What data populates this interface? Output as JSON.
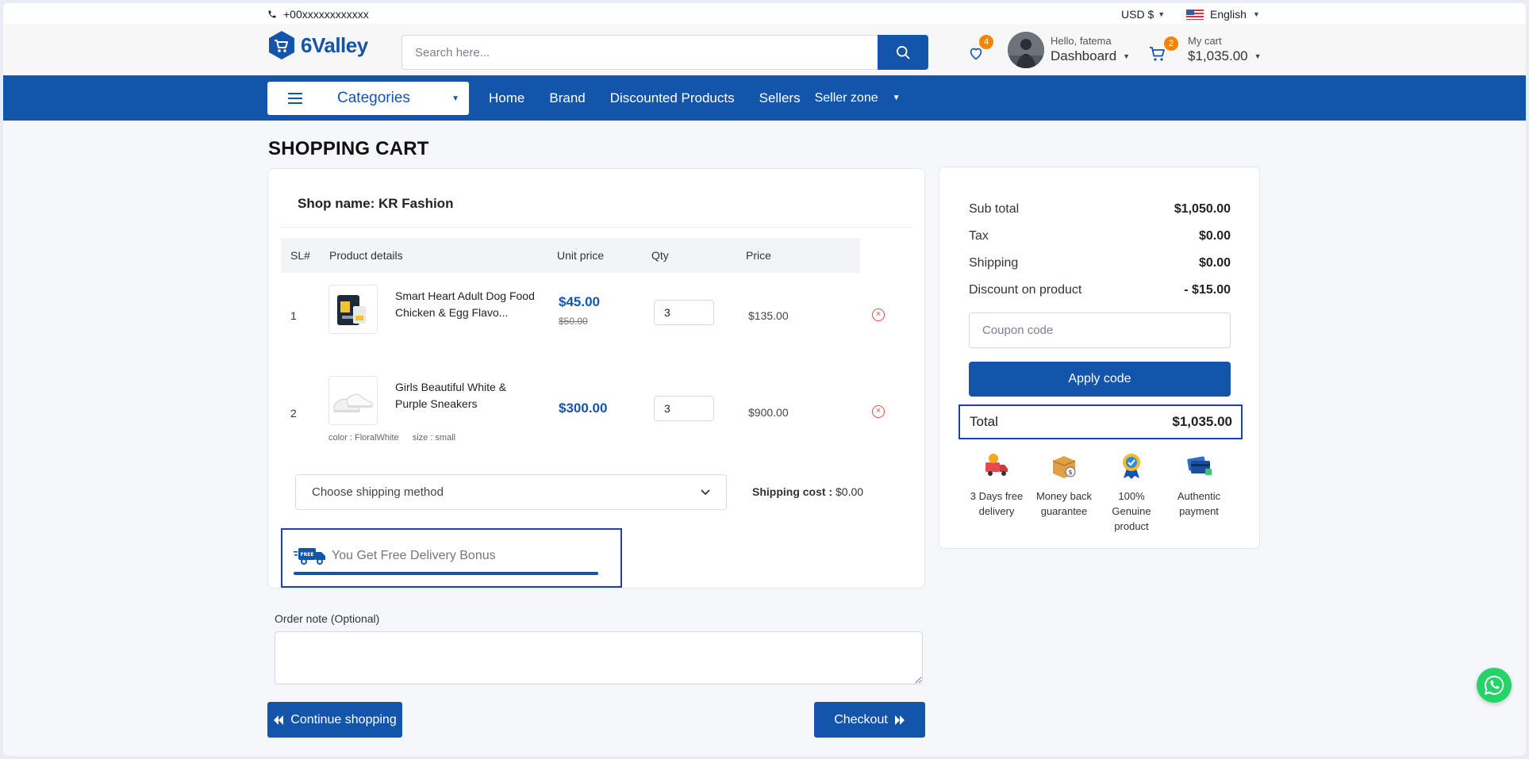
{
  "topbar": {
    "phone": "+00xxxxxxxxxxxx",
    "currency": "USD $",
    "language": "English"
  },
  "header": {
    "logo_text": "6Valley",
    "search_placeholder": "Search here...",
    "wishlist_count": "4",
    "user_greeting": "Hello, fatema",
    "user_menu": "Dashboard",
    "cart_count": "2",
    "cart_label": "My cart",
    "cart_amount": "$1,035.00"
  },
  "nav": {
    "categories": "Categories",
    "links": [
      "Home",
      "Brand",
      "Discounted Products",
      "Sellers"
    ],
    "seller_zone": "Seller zone"
  },
  "page_title": "SHOPPING CART",
  "cart": {
    "shop_label": "Shop name: KR Fashion",
    "columns": [
      "SL#",
      "Product details",
      "Unit price",
      "Qty",
      "Price"
    ],
    "items": [
      {
        "sl": "1",
        "name": "Smart Heart Adult Dog Food Chicken & Egg Flavo...",
        "unit_price": "$45.00",
        "old_price": "$50.00",
        "qty": "3",
        "price": "$135.00",
        "remove_icon": "remove-circle-icon"
      },
      {
        "sl": "2",
        "name": "Girls Beautiful White & Purple Sneakers",
        "unit_price": "$300.00",
        "qty": "3",
        "price": "$900.00",
        "color": "color : FloralWhite",
        "size": "size : small",
        "remove_icon": "remove-circle-icon"
      }
    ],
    "shipping_method": "Choose shipping method",
    "shipping_cost_label": "Shipping cost :",
    "shipping_cost_value": "$0.00",
    "free_delivery": "You Get Free Delivery Bonus",
    "free_delivery_progress": 1.0
  },
  "order_note_label": "Order note (Optional)",
  "buttons": {
    "continue": "Continue shopping",
    "checkout": "Checkout"
  },
  "summary": {
    "rows": [
      {
        "label": "Sub total",
        "value": "$1,050.00"
      },
      {
        "label": "Tax",
        "value": "$0.00"
      },
      {
        "label": "Shipping",
        "value": "$0.00"
      },
      {
        "label": "Discount on product",
        "value": "- $15.00"
      }
    ],
    "coupon_placeholder": "Coupon code",
    "apply": "Apply code",
    "total_label": "Total",
    "total_value": "$1,035.00",
    "features": [
      {
        "line1": "3 Days free",
        "line2": "delivery",
        "line3": ""
      },
      {
        "line1": "Money back",
        "line2": "guarantee",
        "line3": ""
      },
      {
        "line1": "100%",
        "line2": "Genuine",
        "line3": "product"
      },
      {
        "line1": "Authentic",
        "line2": "payment",
        "line3": ""
      }
    ]
  },
  "colors": {
    "primary": "#1455ac",
    "badge": "#f58300",
    "highlight_border": "#1c3fba",
    "remove": "#e54b4b",
    "whatsapp": "#25d366"
  }
}
